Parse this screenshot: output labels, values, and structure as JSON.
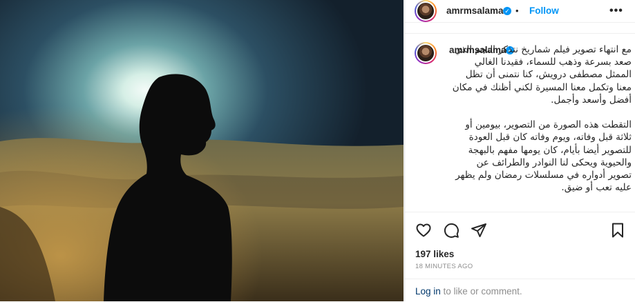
{
  "post": {
    "username": "amrmsalama",
    "follow_label": "Follow",
    "dot": "•",
    "more_label": "•••",
    "caption_p1": "مع انتهاء تصوير فيلم شماريخ نتذكر النجم الذي صعد بسرعة وذهب للسماء، فقيدنا الغالي الممثل مصطفى درويش، كنا نتمنى أن تظل معنا وتكمل معنا المسيرة لكني أظنك في مكان أفضل وأسعد وأجمل.",
    "caption_p2": "التقطت هذه الصورة من التصوير، بيومين أو ثلاثة قبل وفاته، ويوم وفاته كان قبل العودة للتصوير أيضا بأيام، كان يومها مفهم بالبهجة والحيوية ويحكى لنا النوادر والطرائف عن تصوير أدواره في مسلسلات رمضان ولم يظهر عليه تعب أو ضيق.",
    "likes": "197 likes",
    "time": "18 MINUTES AGO",
    "login_link": "Log in",
    "login_rest": " to like or comment."
  },
  "icons": {
    "verified": "verified-badge-icon",
    "like": "heart-icon",
    "comment": "comment-icon",
    "share": "paper-plane-icon",
    "save": "bookmark-icon"
  },
  "colors": {
    "accent": "#0095f6",
    "link": "#00376b",
    "muted": "#8e8e8e",
    "text": "#262626"
  }
}
